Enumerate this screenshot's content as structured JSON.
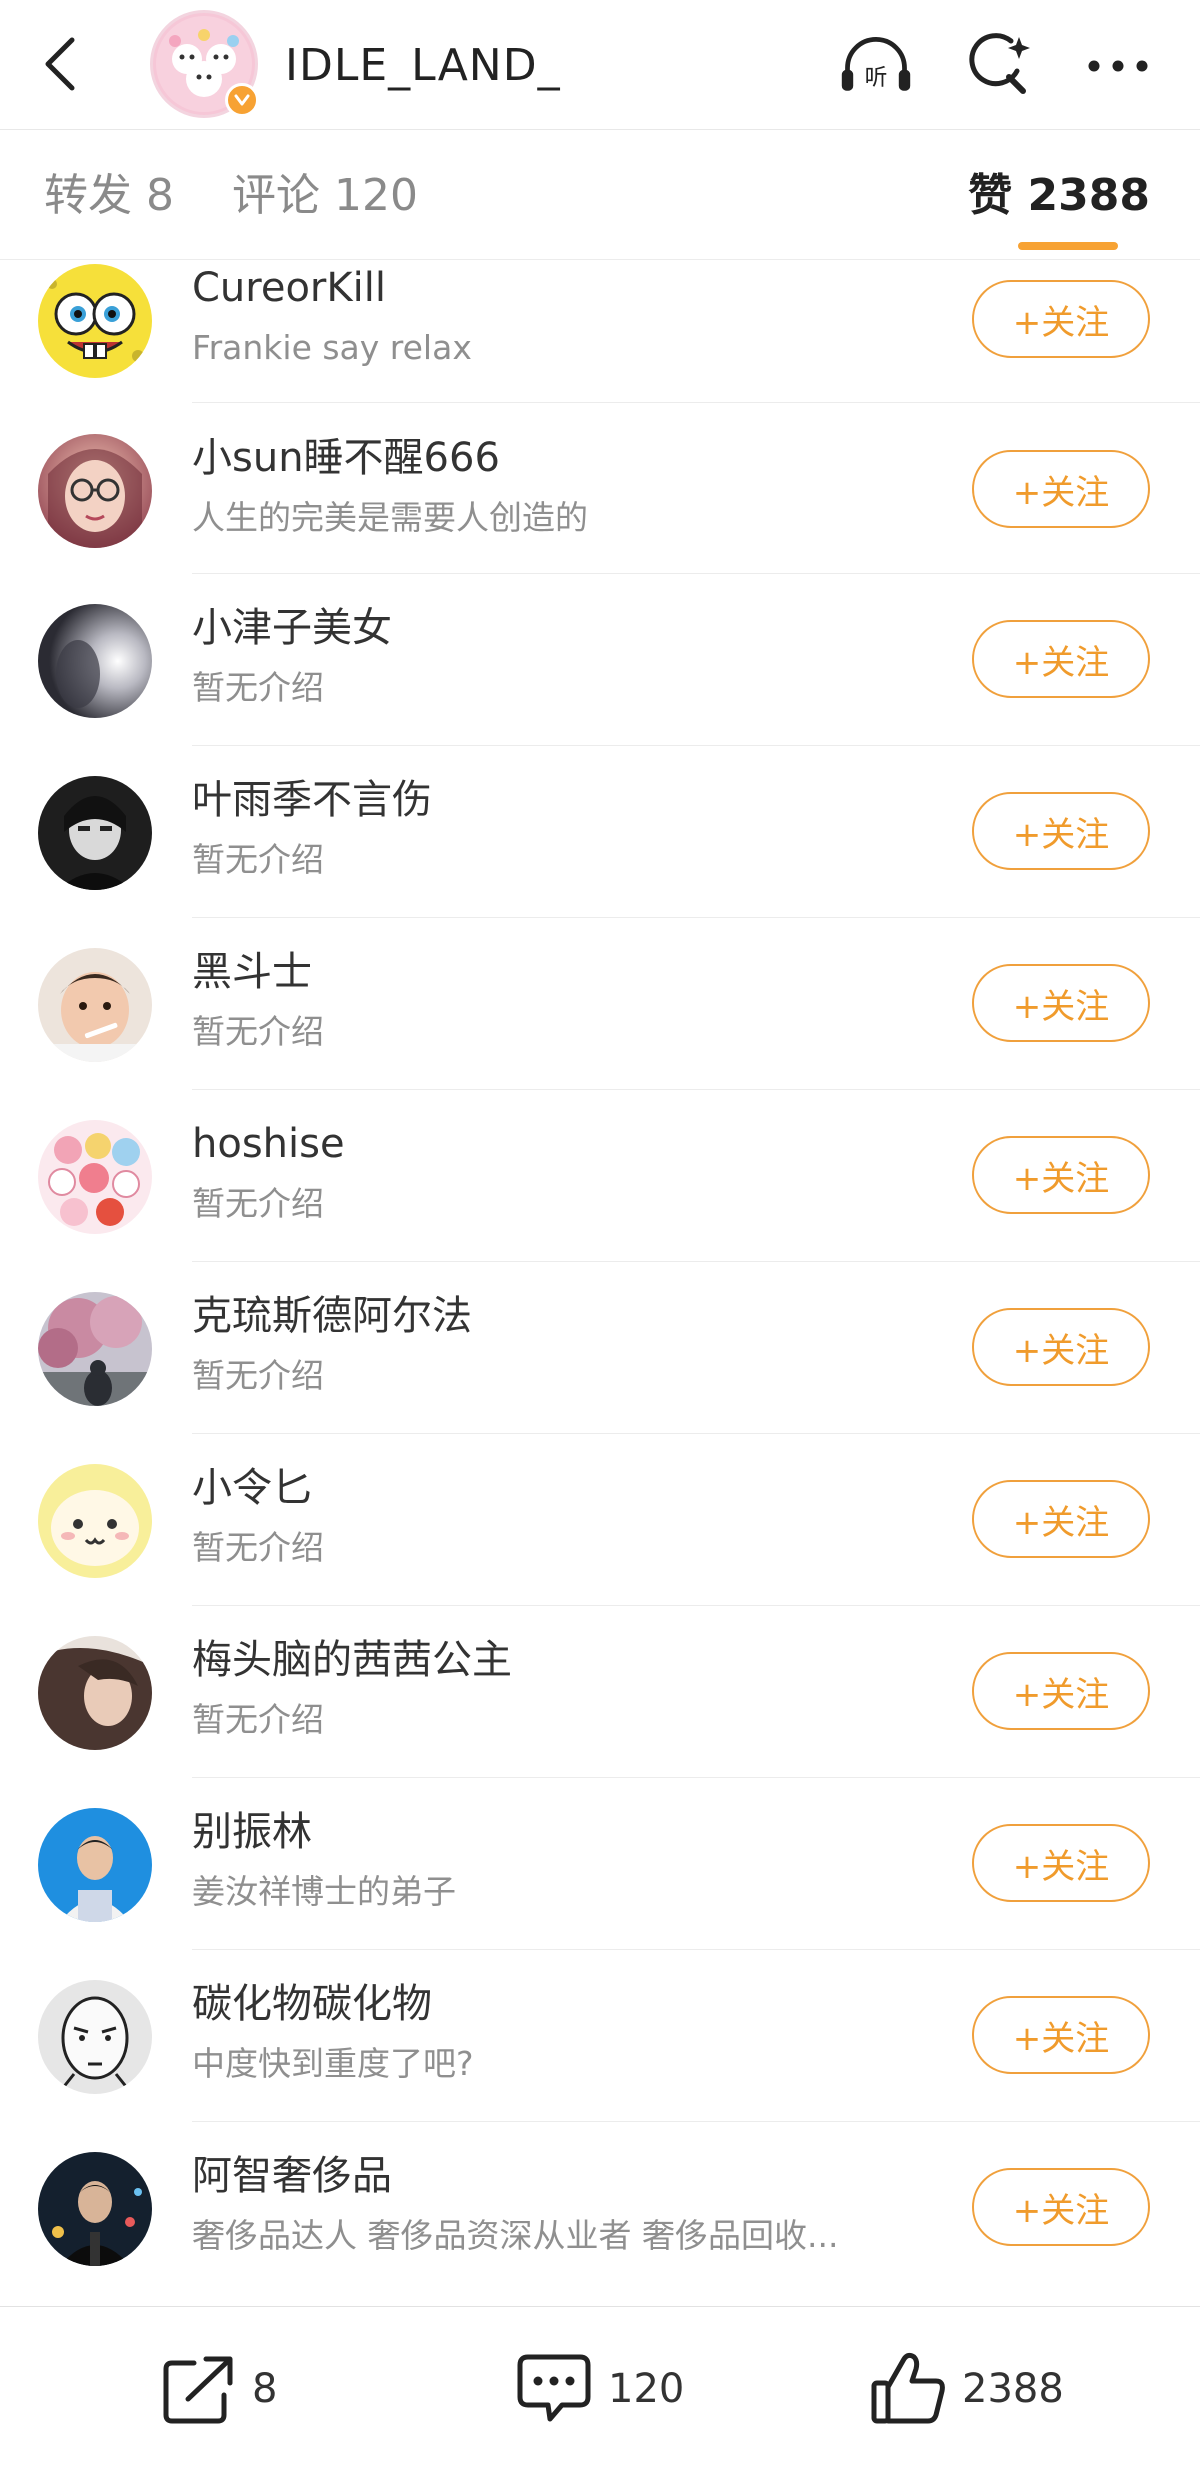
{
  "header": {
    "title": "IDLE_LAND_",
    "icons": {
      "back": "back-chevron-icon",
      "listen": "listen-headphones-icon",
      "listen_label": "听",
      "search": "search-sparkle-icon",
      "more": "more-dots-icon"
    }
  },
  "tabs": {
    "reposts": "转发 8",
    "comments": "评论 120",
    "likes": "赞 2388",
    "active": "likes"
  },
  "users": [
    {
      "name": "CureorKill",
      "desc": "Frankie say relax",
      "follow": "+关注"
    },
    {
      "name": "小sun睡不醒666",
      "desc": "人生的完美是需要人创造的",
      "follow": "+关注"
    },
    {
      "name": "小津子美女",
      "desc": "暂无介绍",
      "follow": "+关注"
    },
    {
      "name": "叶雨季不言伤",
      "desc": "暂无介绍",
      "follow": "+关注"
    },
    {
      "name": "黑斗士",
      "desc": "暂无介绍",
      "follow": "+关注"
    },
    {
      "name": "hoshise",
      "desc": "暂无介绍",
      "follow": "+关注"
    },
    {
      "name": "克琉斯德阿尔法",
      "desc": "暂无介绍",
      "follow": "+关注"
    },
    {
      "name": "小令匕",
      "desc": "暂无介绍",
      "follow": "+关注"
    },
    {
      "name": "梅头脑的茜茜公主",
      "desc": "暂无介绍",
      "follow": "+关注"
    },
    {
      "name": "别振林",
      "desc": "姜汝祥博士的弟子",
      "follow": "+关注"
    },
    {
      "name": "碳化物碳化物",
      "desc": "中度快到重度了吧?",
      "follow": "+关注"
    },
    {
      "name": "阿智奢侈品",
      "desc": "奢侈品达人 奢侈品资深从业者 奢侈品回收...",
      "follow": "+关注"
    }
  ],
  "bottom_bar": {
    "repost_count": "8",
    "comment_count": "120",
    "like_count": "2388",
    "icons": {
      "repost": "share-icon",
      "comment": "comment-bubble-icon",
      "like": "thumbs-up-icon"
    }
  },
  "colors": {
    "accent": "#f7a233",
    "follow_text": "#f09b2c",
    "muted": "#8f8f8f",
    "divider": "#ececec"
  }
}
